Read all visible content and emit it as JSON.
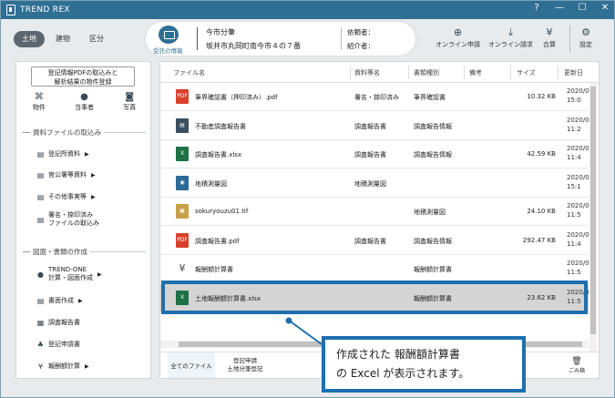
{
  "app": {
    "title": "TREND REX",
    "help": "?",
    "minimize": "—",
    "maximize": "☐",
    "close": "✕"
  },
  "tabs": [
    "土地",
    "建物",
    "区分"
  ],
  "info": {
    "icon_label": "受託の情報",
    "line1": "今市分筆",
    "line2": "坂井市丸岡町南今市４の７番",
    "client_label": "依頼者：",
    "intro_label": "紹介者："
  },
  "toolbar": {
    "online_apply": "オンライン申請",
    "online_request": "オンライン請求",
    "gouhyou": "合算",
    "settings": "設定"
  },
  "left": {
    "register_btn_line1": "登記情報PDFの取込みと",
    "register_btn_line2": "解析結果の物件登録",
    "icons": [
      "物件",
      "当事者",
      "写真"
    ],
    "section1": "資料ファイルの取込み",
    "section1_items": [
      "登記所資料",
      "官公署等資料",
      "その他事実等",
      "署名・捺印済み",
      "ファイルの取込み"
    ],
    "section2": "図面・書類の作成",
    "section2_items": [
      "TREND-ONE",
      "計算・図面作成",
      "書面作成",
      "調査報告書",
      "登記申請書",
      "報酬額計算"
    ]
  },
  "table": {
    "headers": [
      "ファイル名",
      "資料等名",
      "書類種別",
      "備考",
      "サイズ",
      "更新日"
    ],
    "rows": [
      {
        "type": "pdf",
        "name": "筆界確認書（押印済み）.pdf",
        "c2": "署名・捺印済み",
        "c3": "筆界確認書",
        "size": "10.32 KB",
        "d1": "2020/0",
        "d2": "15:0"
      },
      {
        "type": "doc",
        "name": "不動産調査報告書",
        "c2": "調査報告書",
        "c3": "調査報告情報",
        "size": "",
        "d1": "2020/0",
        "d2": "11:2"
      },
      {
        "type": "xls",
        "name": "調査報告書.xlsx",
        "c2": "調査報告書",
        "c3": "調査報告情報",
        "size": "42.59 KB",
        "d1": "2020/0",
        "d2": "11:4"
      },
      {
        "type": "map",
        "name": "地積測量図",
        "c2": "地積測量図",
        "c3": "",
        "size": "",
        "d1": "2020/0",
        "d2": "15:1"
      },
      {
        "type": "img",
        "name": "sokuryouzu01.tif",
        "c2": "",
        "c3": "地積測量図",
        "size": "24.10 KB",
        "d1": "2020/0",
        "d2": "11:5"
      },
      {
        "type": "pdf",
        "name": "調査報告書.pdf",
        "c2": "調査報告書",
        "c3": "調査報告情報",
        "size": "292.47 KB",
        "d1": "2020/0",
        "d2": "11:4"
      },
      {
        "type": "yen",
        "name": "報酬額計算書",
        "c2": "",
        "c3": "報酬額計算書",
        "size": "",
        "d1": "2020/0",
        "d2": "11:5"
      },
      {
        "type": "xls",
        "name": "土地報酬額計算書.xlsx",
        "c2": "",
        "c3": "報酬額計算書",
        "size": "23.62 KB",
        "d1": "2020/0",
        "d2": "11:5"
      }
    ]
  },
  "bottom": {
    "tab_all": "全てのファイル",
    "tab2_line1": "登記申請",
    "tab2_line2": "土地分筆登記",
    "trash": "ごみ箱"
  },
  "callout": {
    "line1": "作成された 報酬額計算書",
    "line2": "の Excel が表示されます。"
  },
  "colors": {
    "titlebar": "#2f6f93",
    "highlight": "#1f6fae",
    "pdf": "#d9412b",
    "xls": "#1e7145"
  }
}
